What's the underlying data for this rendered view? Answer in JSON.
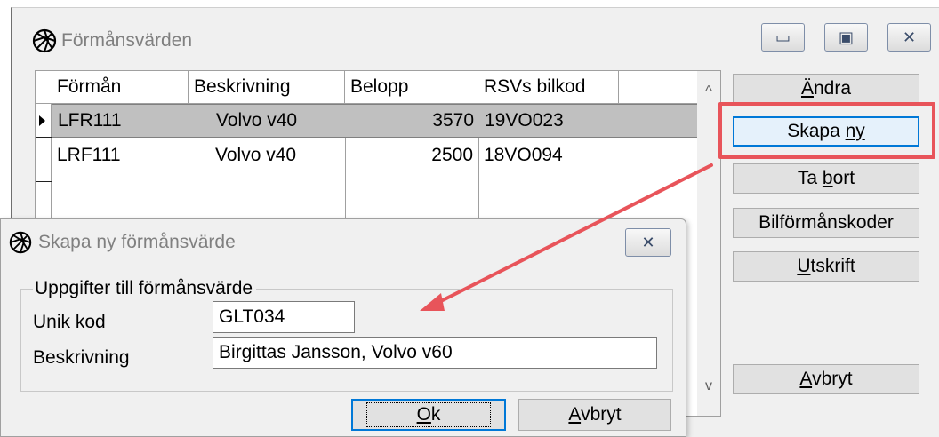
{
  "window": {
    "title": "Förmånsvärden",
    "minimize_glyph": "▭",
    "maximize_glyph": "▣",
    "close_glyph": "✕"
  },
  "grid": {
    "columns": [
      "Förmån",
      "Beskrivning",
      "Belopp",
      "RSVs bilkod"
    ],
    "rows": [
      {
        "formansid": "LFR111",
        "beskrivning": "Volvo v40",
        "belopp": "3570",
        "bilkod": "19VO023",
        "selected": true
      },
      {
        "formansid": "LRF111",
        "beskrivning": "Volvo v40",
        "belopp": "2500",
        "bilkod": "18VO094",
        "selected": false
      }
    ],
    "scroll_up": "^",
    "scroll_down": "v"
  },
  "side_buttons": {
    "andra": {
      "pre": "",
      "accel": "Ä",
      "post": "ndra"
    },
    "skapa_ny": {
      "pre": "Skapa ",
      "accel": "ny",
      "post": ""
    },
    "ta_bort": {
      "pre": "Ta ",
      "accel": "b",
      "post": "ort"
    },
    "bilformanskoder": {
      "pre": "Bilförmånskoder",
      "accel": "",
      "post": ""
    },
    "utskrift": {
      "pre": "",
      "accel": "U",
      "post": "tskrift"
    },
    "avbryt": {
      "pre": "",
      "accel": "A",
      "post": "vbryt"
    }
  },
  "dialog": {
    "title": "Skapa ny förmånsvärde",
    "close_glyph": "✕",
    "group_label": "Uppgifter till förmånsvärde",
    "unik_kod_label": "Unik kod",
    "unik_kod_value": "GLT034",
    "beskrivning_label": "Beskrivning",
    "beskrivning_value": "Birgittas Jansson, Volvo v60",
    "ok": {
      "pre": "",
      "accel": "O",
      "post": "k"
    },
    "avbryt": {
      "pre": "",
      "accel": "A",
      "post": "vbryt"
    }
  },
  "colors": {
    "annotation_red": "#e8545a",
    "focus_blue": "#0078d7",
    "selected_row": "#c0c0c0"
  }
}
